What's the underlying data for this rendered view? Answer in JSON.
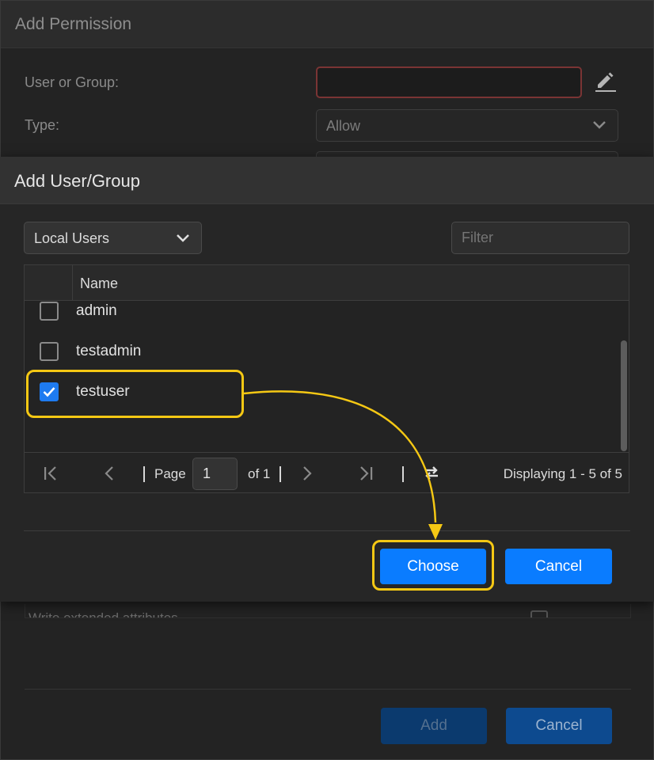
{
  "background_dialog": {
    "title": "Add Permission",
    "user_or_group_label": "User or Group:",
    "user_or_group_value": "",
    "type_label": "Type:",
    "type_value": "Allow",
    "partial_row_text": "Write extended attributes",
    "add_label": "Add",
    "cancel_label": "Cancel"
  },
  "dialog": {
    "title": "Add User/Group",
    "source_select": "Local Users",
    "filter_placeholder": "Filter",
    "filter_value": "",
    "column_name": "Name",
    "rows": [
      {
        "name": "admin",
        "checked": false
      },
      {
        "name": "testadmin",
        "checked": false
      },
      {
        "name": "testuser",
        "checked": true
      }
    ],
    "pager": {
      "page_label": "Page",
      "page_value": "1",
      "of_label": "of 1",
      "displaying": "Displaying 1 - 5 of 5"
    },
    "choose_label": "Choose",
    "cancel_label": "Cancel"
  },
  "annotations": {
    "highlight_color": "#f5c814",
    "highlighted_items": [
      "testuser",
      "Choose"
    ]
  },
  "colors": {
    "primary_button": "#0a7cff",
    "checkbox_checked": "#1e7bf0",
    "invalid_border": "#7a3434"
  }
}
